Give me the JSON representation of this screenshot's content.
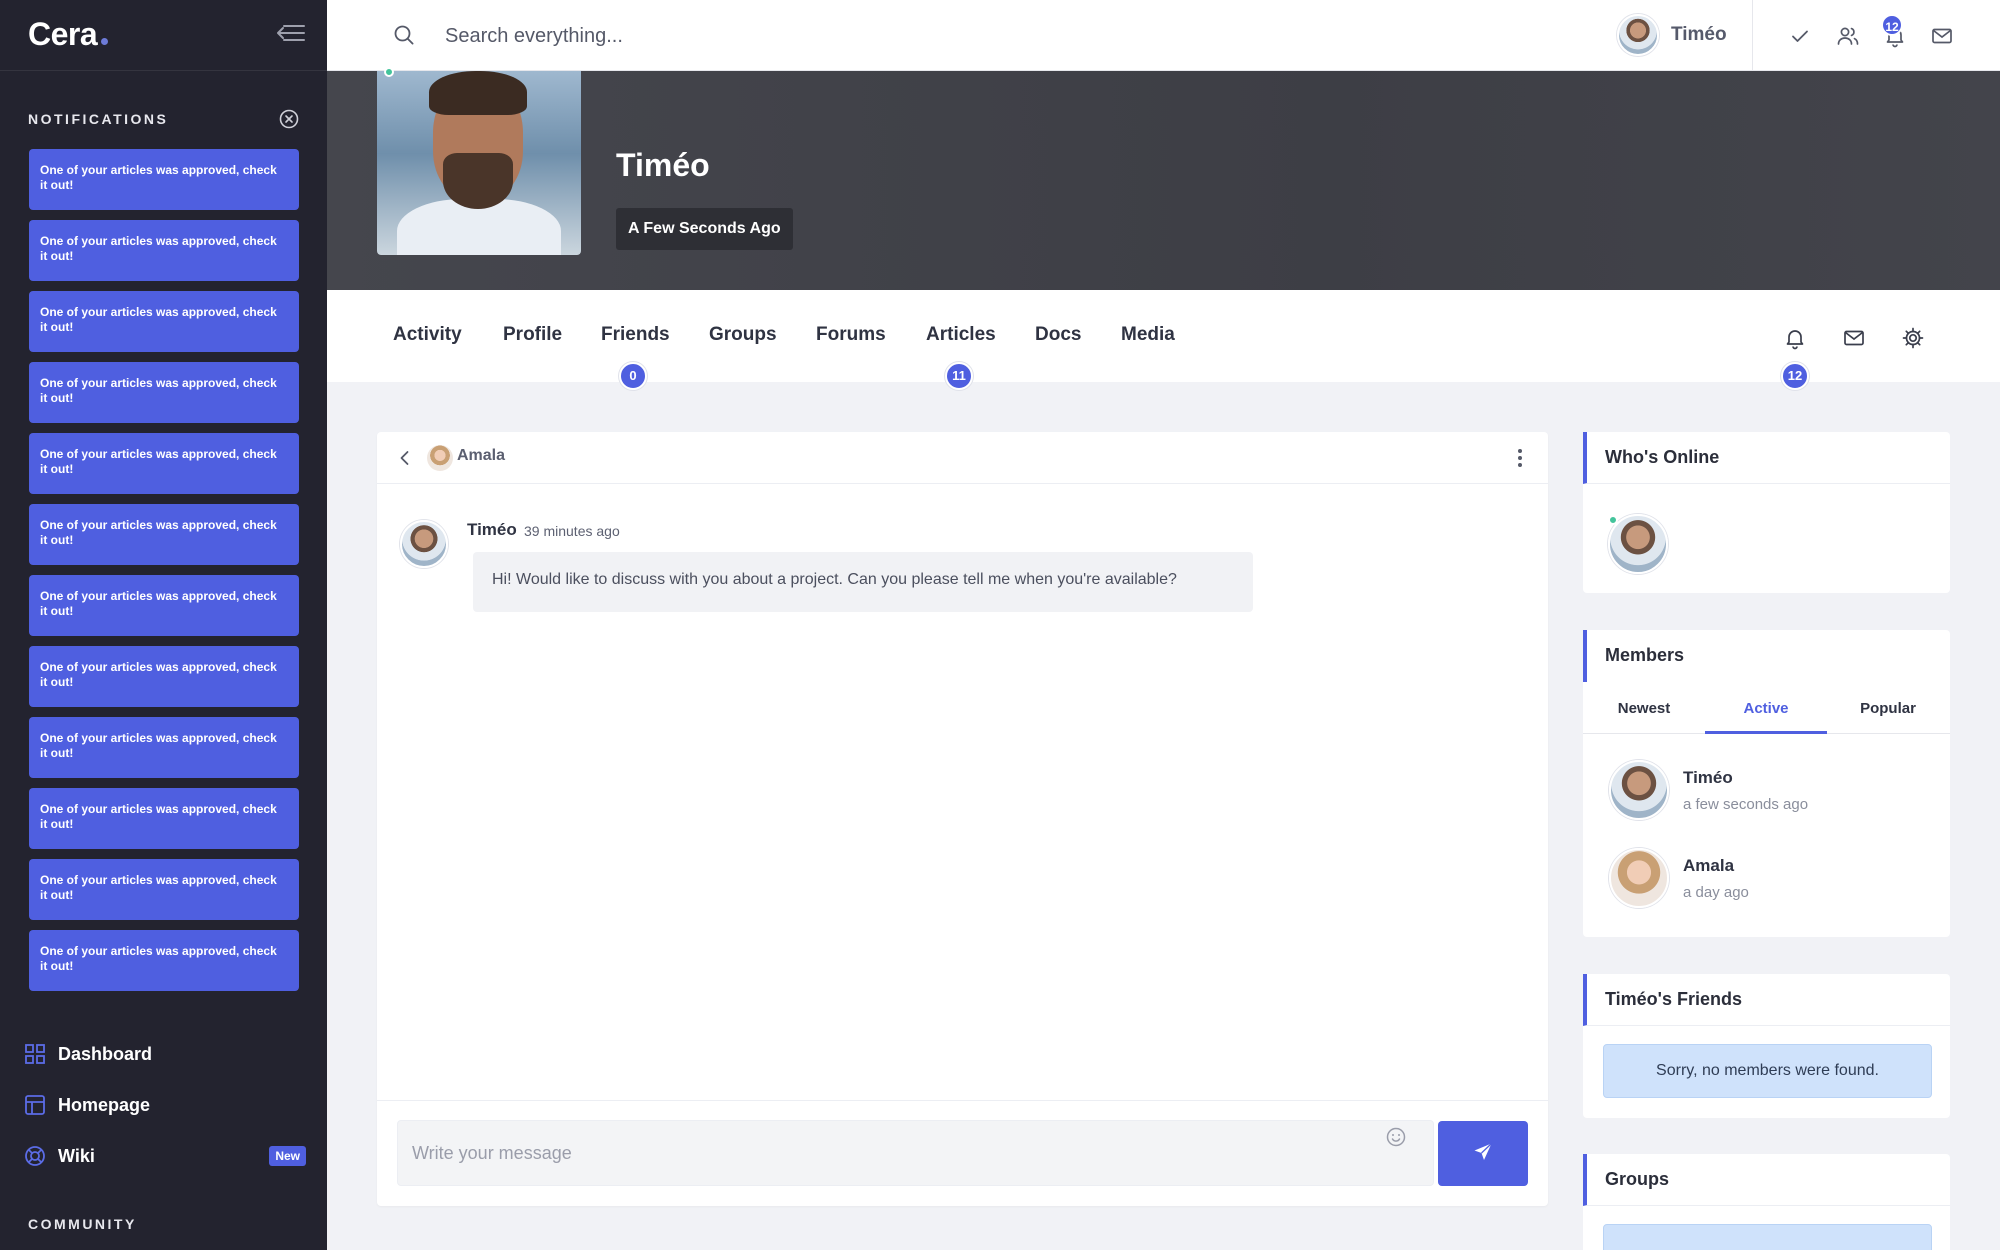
{
  "app": {
    "logo_text": "Cera"
  },
  "sidebar": {
    "notifications_heading": "NOTIFICATIONS",
    "notifications": [
      "One of your articles was approved, check it out!",
      "One of your articles was approved, check it out!",
      "One of your articles was approved, check it out!",
      "One of your articles was approved, check it out!",
      "One of your articles was approved, check it out!",
      "One of your articles was approved, check it out!",
      "One of your articles was approved, check it out!",
      "One of your articles was approved, check it out!",
      "One of your articles was approved, check it out!",
      "One of your articles was approved, check it out!",
      "One of your articles was approved, check it out!",
      "One of your articles was approved, check it out!"
    ],
    "nav": [
      {
        "label": "Dashboard",
        "icon": "grid-icon"
      },
      {
        "label": "Homepage",
        "icon": "layout-icon"
      },
      {
        "label": "Wiki",
        "icon": "lifebuoy-icon",
        "badge": "New"
      }
    ],
    "community_heading": "COMMUNITY"
  },
  "topbar": {
    "search_placeholder": "Search everything...",
    "user_name": "Timéo",
    "notification_count": "12",
    "icons": [
      "check-icon",
      "users-icon",
      "bell-icon",
      "mail-icon"
    ]
  },
  "cover": {
    "name": "Timéo",
    "last_active": "A Few Seconds Ago"
  },
  "profile_tabs": {
    "items": [
      {
        "label": "Activity"
      },
      {
        "label": "Profile"
      },
      {
        "label": "Friends",
        "count": "0"
      },
      {
        "label": "Groups"
      },
      {
        "label": "Forums"
      },
      {
        "label": "Articles",
        "count": "11"
      },
      {
        "label": "Docs"
      },
      {
        "label": "Media"
      }
    ],
    "notification_count": "12"
  },
  "chat": {
    "recipient": "Amala",
    "messages": [
      {
        "author": "Timéo",
        "time": "39 minutes ago",
        "text": "Hi! Would like to discuss with you about a project. Can you please tell me when you're available?"
      }
    ],
    "input_placeholder": "Write your message"
  },
  "widgets": {
    "whos_online": {
      "title": "Who's Online"
    },
    "members": {
      "title": "Members",
      "tabs": [
        "Newest",
        "Active",
        "Popular"
      ],
      "active_tab": "Active",
      "list": [
        {
          "name": "Timéo",
          "time": "a few seconds ago"
        },
        {
          "name": "Amala",
          "time": "a day ago"
        }
      ]
    },
    "friends": {
      "title": "Timéo's Friends",
      "empty": "Sorry, no members were found."
    },
    "groups": {
      "title": "Groups"
    }
  },
  "colors": {
    "accent": "#4f5fe0",
    "sidebar_bg": "#23232f",
    "cover_bg": "#45464d",
    "online": "#43c49b"
  }
}
